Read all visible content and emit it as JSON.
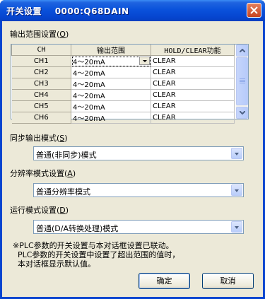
{
  "window": {
    "title": "开关设置    0000:Q68DAIN"
  },
  "output_range": {
    "group_label": "输出范围设置(",
    "group_accel": "O",
    "group_close": ")",
    "columns": [
      "CH",
      "输出范围",
      "HOLD/CLEAR功能"
    ],
    "rows": [
      {
        "ch": "CH1",
        "range": "4～20mA",
        "hold": "CLEAR"
      },
      {
        "ch": "CH2",
        "range": "4～20mA",
        "hold": "CLEAR"
      },
      {
        "ch": "CH3",
        "range": "4～20mA",
        "hold": "CLEAR"
      },
      {
        "ch": "CH4",
        "range": "4～20mA",
        "hold": "CLEAR"
      },
      {
        "ch": "CH5",
        "range": "4～20mA",
        "hold": "CLEAR"
      },
      {
        "ch": "CH6",
        "range": "4～20mA",
        "hold": "CLEAR"
      }
    ]
  },
  "sync_mode": {
    "label": "同步输出模式(",
    "accel": "S",
    "close": ")",
    "value": "普通(非同步)模式"
  },
  "resolution_mode": {
    "label": "分辨率模式设置(",
    "accel": "A",
    "close": ")",
    "value": "普通分辨率模式"
  },
  "run_mode": {
    "label": "运行模式设置(",
    "accel": "D",
    "close": ")",
    "value": "普通(D/A转换处理)模式"
  },
  "note": {
    "line1": "※PLC参数的开关设置与本对话框设置已联动。",
    "line2": "  PLC参数的开关设置中设置了超出范围的值时，",
    "line3": "  本对话框显示默认值。"
  },
  "buttons": {
    "ok": "确定",
    "cancel": "取消"
  }
}
